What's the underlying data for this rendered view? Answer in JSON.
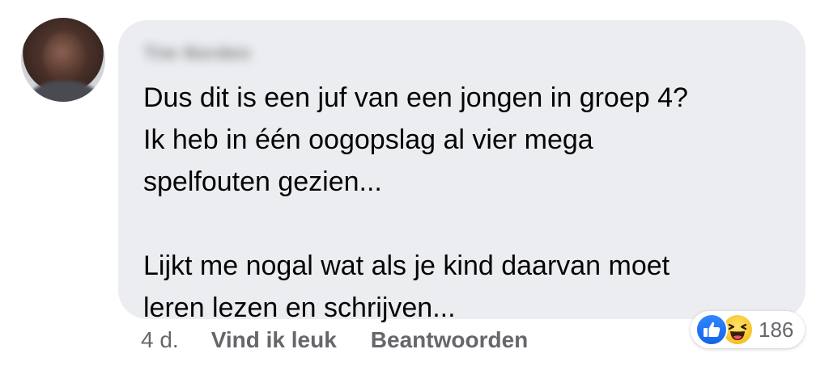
{
  "comment": {
    "author_name": "Tim Norden",
    "lines": [
      "Dus dit is een juf van een jongen in groep 4?",
      "Ik heb in één oogopslag al vier mega",
      "spelfouten gezien..."
    ],
    "lines_second_paragraph": [
      "Lijkt me nogal wat als je kind daarvan moet",
      "leren lezen en schrijven..."
    ]
  },
  "actions": {
    "time": "4 d.",
    "like_label": "Vind ik leuk",
    "reply_label": "Beantwoorden"
  },
  "reactions": {
    "icons": [
      "like-icon",
      "haha-icon"
    ],
    "count": "186"
  },
  "colors": {
    "bubble_bg": "#ecedf0",
    "like_blue": "#1877f2",
    "haha_yellow": "#f7c325",
    "secondary_text": "#65676b"
  }
}
